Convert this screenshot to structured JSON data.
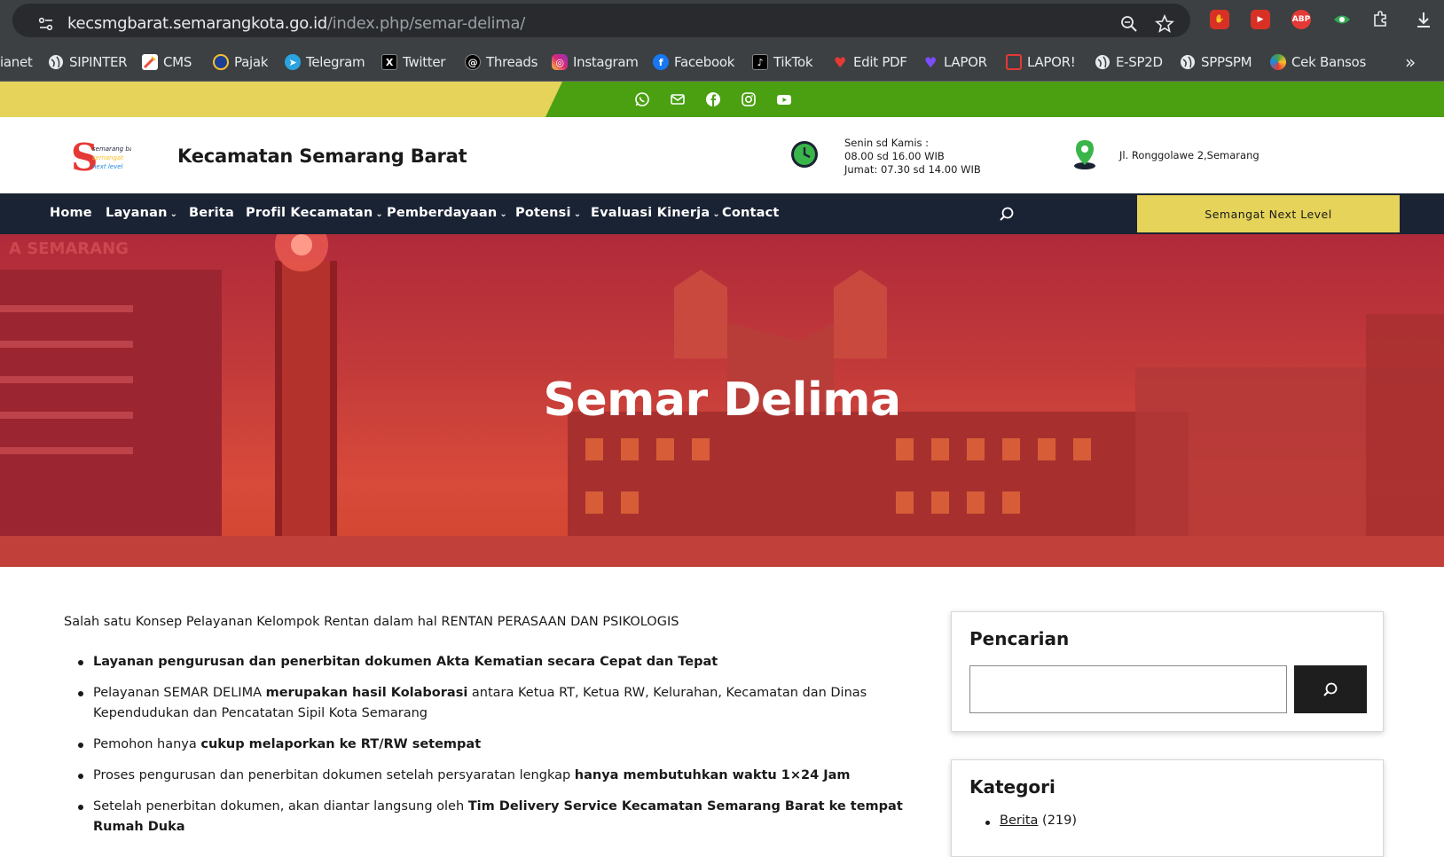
{
  "browser": {
    "url_host": "kecsmgbarat.semarangkota.go.id",
    "url_path": "/index.php/semar-delima/",
    "bookmarks": [
      {
        "label": "ianet",
        "icon": "bookmark-icon",
        "color": "#3c4043"
      },
      {
        "label": "SIPINTER",
        "icon": "globe-icon",
        "color": "#e8eaed"
      },
      {
        "label": "CMS",
        "icon": "cms-icon",
        "color": "#e94f3b"
      },
      {
        "label": "Pajak",
        "icon": "pajak-icon",
        "color": "#1c3f94"
      },
      {
        "label": "Telegram",
        "icon": "telegram-icon",
        "color": "#2aa3df"
      },
      {
        "label": "Twitter",
        "icon": "x-icon",
        "color": "#000000"
      },
      {
        "label": "Threads",
        "icon": "threads-icon",
        "color": "#000000"
      },
      {
        "label": "Instagram",
        "icon": "instagram-icon",
        "color": "#d62976"
      },
      {
        "label": "Facebook",
        "icon": "facebook-icon",
        "color": "#1877f2"
      },
      {
        "label": "TikTok",
        "icon": "tiktok-icon",
        "color": "#000000"
      },
      {
        "label": "Edit PDF",
        "icon": "heart-icon",
        "color": "#e53935"
      },
      {
        "label": "LAPOR",
        "icon": "lapor-icon",
        "color": "#7b4dff"
      },
      {
        "label": "LAPOR!",
        "icon": "lapor2-icon",
        "color": "#e53935"
      },
      {
        "label": "E-SP2D",
        "icon": "globe-icon",
        "color": "#e8eaed"
      },
      {
        "label": "SPPSPM",
        "icon": "globe-icon",
        "color": "#e8eaed"
      },
      {
        "label": "Cek Bansos",
        "icon": "bansos-icon",
        "color": "#43a047"
      }
    ],
    "ext_abp": "ABP",
    "more_bookmarks": "»"
  },
  "site": {
    "title": "Kecamatan Semarang Barat",
    "logo_letter": "S",
    "logo_line1": "semarang barat",
    "logo_line2": "semangat",
    "logo_line3": "next level",
    "hours_line1": "Senin sd Kamis :",
    "hours_line2": "08.00 sd 16.00 WIB",
    "hours_line3": "Jumat: 07.30 sd 14.00 WIB",
    "address": "Jl. Ronggolawe 2,Semarang"
  },
  "nav": {
    "items": [
      {
        "label": "Home",
        "caret": ""
      },
      {
        "label": "Layanan",
        "caret": "⌄"
      },
      {
        "label": "Berita",
        "caret": ""
      },
      {
        "label": "Profil Kecamatan",
        "caret": "⌄"
      },
      {
        "label": "Pemberdayaan",
        "caret": "⌄"
      },
      {
        "label": "Potensi",
        "caret": "⌄"
      },
      {
        "label": "Evaluasi Kinerja",
        "caret": "⌄"
      },
      {
        "label": "Contact",
        "caret": ""
      }
    ],
    "cta": "Semangat Next Level"
  },
  "hero": {
    "title": "Semar Delima",
    "bg_text": "A SEMARANG"
  },
  "content": {
    "intro": "Salah satu Konsep Pelayanan Kelompok Rentan dalam hal RENTAN  PERASAAN DAN  PSIKOLOGIS",
    "bullets": [
      {
        "a": "",
        "b": "Layanan pengurusan dan penerbitan dokumen Akta Kematian secara Cepat dan Tepat",
        "c": ""
      },
      {
        "a": "Pelayanan SEMAR DELIMA ",
        "b": "merupakan hasil Kolaborasi",
        "c": " antara Ketua RT, Ketua RW, Kelurahan, Kecamatan dan Dinas Kependudukan dan Pencatatan Sipil Kota Semarang"
      },
      {
        "a": "Pemohon hanya ",
        "b": "cukup melaporkan ke RT/RW setempat",
        "c": ""
      },
      {
        "a": "Proses pengurusan dan penerbitan dokumen setelah persyaratan lengkap ",
        "b": "hanya membutuhkan waktu 1×24 Jam",
        "c": ""
      },
      {
        "a": "Setelah penerbitan dokumen, akan diantar langsung oleh ",
        "b": "Tim Delivery Service Kecamatan Semarang Barat ke tempat Rumah Duka",
        "c": ""
      }
    ]
  },
  "sidebar": {
    "search_title": "Pencarian",
    "search_value": "",
    "category_title": "Kategori",
    "categories": [
      {
        "label": "Berita",
        "count": "(219)"
      }
    ]
  },
  "colors": {
    "yellow": "#e5d35a",
    "green": "#4aa011",
    "nav": "#1a2333",
    "hero": "#c23a3a"
  }
}
